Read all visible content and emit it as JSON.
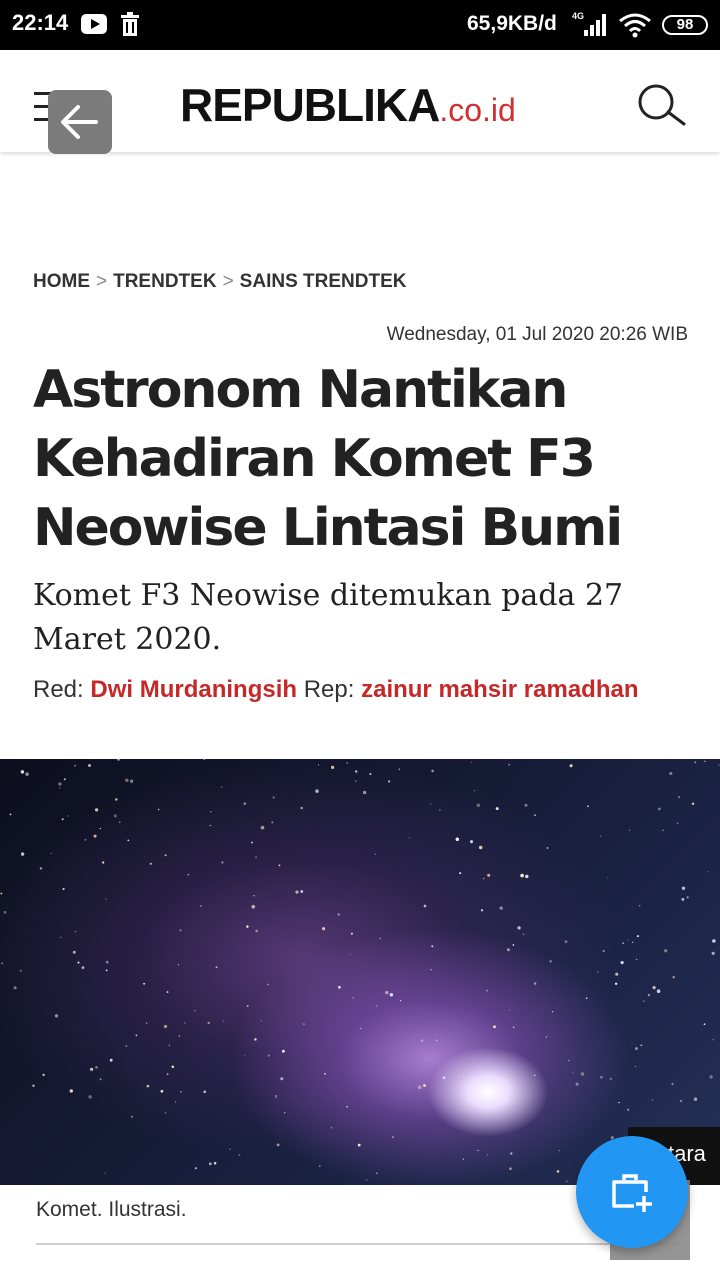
{
  "status_bar": {
    "time": "22:14",
    "speed": "65,9KB/d",
    "battery": "98",
    "network": "4G"
  },
  "header": {
    "logo_main": "REPUBLIKA",
    "logo_sub": ".co.id"
  },
  "breadcrumb": {
    "items": [
      "HOME",
      "TRENDTEK",
      "SAINS TRENDTEK"
    ],
    "separator": ">"
  },
  "article": {
    "date": "Wednesday, 01 Jul 2020 20:26 WIB",
    "title_lines": [
      "Astronom Nantikan",
      "Kehadiran Komet F3",
      "Neowise Lintasi Bumi"
    ],
    "subtitle_lines": [
      "Komet F3 Neowise ditemukan pada 27",
      "Maret 2020."
    ],
    "red_label": "Red:",
    "red_name": "Dwi Murdaningsih",
    "rep_label": "Rep:",
    "rep_name": "zainur mahsir ramadhan",
    "image_caption": "Komet. Ilustrasi.",
    "image_tab": "tara"
  },
  "colors": {
    "brand_red": "#d32f2f",
    "fab_blue": "#2196f3"
  }
}
